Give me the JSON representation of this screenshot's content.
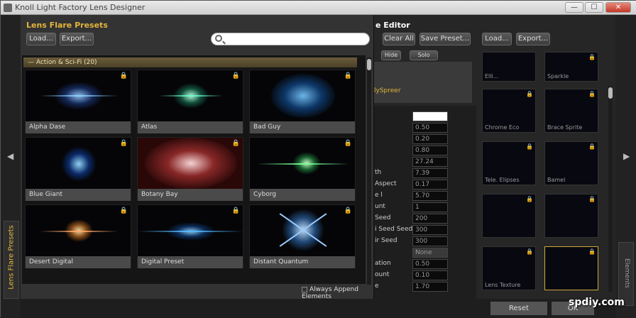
{
  "window": {
    "title": "Knoll Light Factory Lens Designer",
    "minimize": "—",
    "maximize": "☐",
    "close": "✕"
  },
  "presets": {
    "title": "Lens Flare Presets",
    "load_label": "Load...",
    "export_label": "Export...",
    "search_placeholder": "",
    "category": "— Action & Sci-Fi (20)",
    "tiles": [
      {
        "name": "Alpha Dase"
      },
      {
        "name": "Atlas"
      },
      {
        "name": "Bad Guy"
      },
      {
        "name": "Blue Giant"
      },
      {
        "name": "Botany Bay"
      },
      {
        "name": "Cyborg"
      },
      {
        "name": "Desert Digital"
      },
      {
        "name": "Digital Preset"
      },
      {
        "name": "Distant Quantum"
      }
    ],
    "append_label": "Always Append Elements"
  },
  "side_tab": "Lens Flare Presets",
  "editor": {
    "title": "e Editor",
    "clear_all": "Clear All",
    "save_preset": "Save Preset...",
    "hide": "Hide",
    "solo": "Solo",
    "layer_name": "lySpreer",
    "props": [
      {
        "name": "",
        "value": ""
      },
      {
        "name": "",
        "value": "0.50"
      },
      {
        "name": "",
        "value": "0.20"
      },
      {
        "name": "",
        "value": "0.80"
      },
      {
        "name": "",
        "value": "27.24"
      },
      {
        "name": "th",
        "value": "7.39"
      },
      {
        "name": "Aspect",
        "value": "0.17"
      },
      {
        "name": "e l",
        "value": "5.70"
      },
      {
        "name": "unt",
        "value": "1"
      },
      {
        "name": "Seed",
        "value": "200"
      },
      {
        "name": "i Seed Seed",
        "value": "300"
      },
      {
        "name": "ir Seed",
        "value": "300"
      },
      {
        "name": "",
        "value": "None"
      },
      {
        "name": "ation",
        "value": "0.50"
      },
      {
        "name": "ount",
        "value": "0.10"
      },
      {
        "name": "e",
        "value": "1.70"
      }
    ]
  },
  "library": {
    "load_label": "Load...",
    "export_label": "Export...",
    "tiles": [
      {
        "name": "Elli..."
      },
      {
        "name": "Sparkle"
      },
      {
        "name": "Chrome Eco"
      },
      {
        "name": "Brace Sprite"
      },
      {
        "name": "Tele. Elipses"
      },
      {
        "name": "Bamel"
      },
      {
        "name": ""
      },
      {
        "name": ""
      },
      {
        "name": "Lens Texture"
      },
      {
        "name": ""
      }
    ]
  },
  "right_tab": "Elements",
  "bottom": {
    "reset": "Reset",
    "ok": "OK"
  },
  "watermark": "spdiy.com"
}
